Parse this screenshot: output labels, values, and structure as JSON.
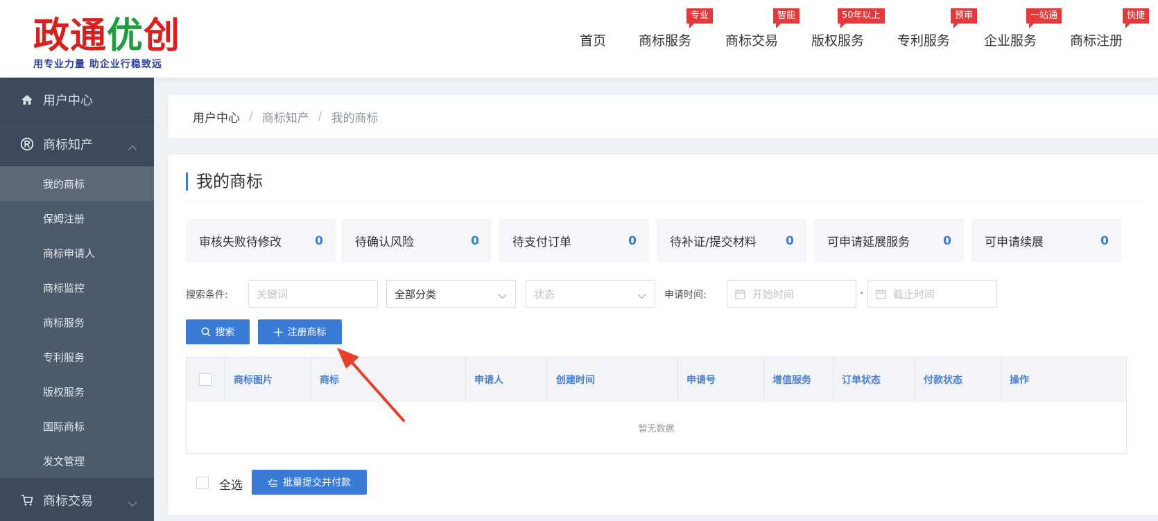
{
  "logo": {
    "title_part1": "政通",
    "title_part2": "优",
    "title_part3": "创",
    "slogan": "用专业力量  助企业行稳致远"
  },
  "nav": {
    "items": [
      {
        "label": "首页",
        "badge": ""
      },
      {
        "label": "商标服务",
        "badge": "专业"
      },
      {
        "label": "商标交易",
        "badge": "智能"
      },
      {
        "label": "版权服务",
        "badge": "50年以上"
      },
      {
        "label": "专利服务",
        "badge": "预审"
      },
      {
        "label": "企业服务",
        "badge": "一站通"
      },
      {
        "label": "商标注册",
        "badge": "快捷"
      }
    ]
  },
  "sidebar": {
    "user_center": "用户中心",
    "trademark_ip": "商标知产",
    "sub_items": [
      "我的商标",
      "保姆注册",
      "商标申请人",
      "商标监控",
      "商标服务",
      "专利服务",
      "版权服务",
      "国际商标",
      "发文管理"
    ],
    "trademark_trade": "商标交易"
  },
  "breadcrumb": [
    "用户中心",
    "商标知产",
    "我的商标"
  ],
  "page_title": "我的商标",
  "stats": [
    {
      "label": "审核失败待修改",
      "value": "0"
    },
    {
      "label": "待确认风险",
      "value": "0"
    },
    {
      "label": "待支付订单",
      "value": "0"
    },
    {
      "label": "待补证/提交材料",
      "value": "0"
    },
    {
      "label": "可申请延展服务",
      "value": "0"
    },
    {
      "label": "可申请续展",
      "value": "0"
    }
  ],
  "filters": {
    "label": "搜索条件:",
    "keyword_placeholder": "关键词",
    "category_value": "全部分类",
    "status_placeholder": "状态",
    "date_label": "申请时间:",
    "start_placeholder": "开始时间",
    "dash": "-",
    "end_placeholder": "截止时间"
  },
  "buttons": {
    "search": "搜索",
    "register": "注册商标",
    "batch_pay": "批量提交并付款"
  },
  "table": {
    "columns": [
      "商标图片",
      "商标",
      "申请人",
      "创建时间",
      "申请号",
      "增值服务",
      "订单状态",
      "付款状态",
      "操作"
    ],
    "empty_text": "暂无数据"
  },
  "footer": {
    "select_all": "全选"
  },
  "colors": {
    "primary": "#3a7bd5",
    "badge": "#e33b3b",
    "sidebar": "#3e4a5b",
    "arrow": "#e8402a"
  }
}
